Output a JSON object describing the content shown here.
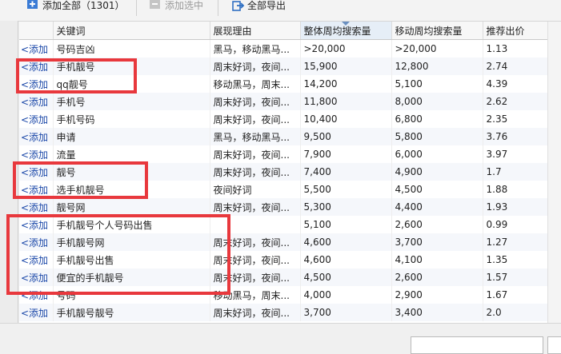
{
  "toolbar": {
    "add_all_label": "添加全部（1301）",
    "add_selected_label": "添加选中",
    "export_all_label": "全部导出"
  },
  "table": {
    "columns": [
      "",
      "关键词",
      "展现理由",
      "整体周均搜索量",
      "移动周均搜索量",
      "推荐出价"
    ],
    "rows": [
      {
        "add": "<添加",
        "keyword": "号码吉凶",
        "reason": "黑马，移动黑马...",
        "total": ">20,000",
        "mobile": ">20,000",
        "bid": "1.13"
      },
      {
        "add": "<添加",
        "keyword": "手机靓号",
        "reason": "周末好词，夜间...",
        "total": "15,900",
        "mobile": "12,800",
        "bid": "2.74"
      },
      {
        "add": "<添加",
        "keyword": "qq靓号",
        "reason": "移动黑马，周末...",
        "total": "14,200",
        "mobile": "5,100",
        "bid": "4.39"
      },
      {
        "add": "<添加",
        "keyword": "手机号",
        "reason": "周末好词，夜间...",
        "total": "11,800",
        "mobile": "8,000",
        "bid": "2.62"
      },
      {
        "add": "<添加",
        "keyword": "手机号码",
        "reason": "周末好词，夜间...",
        "total": "10,400",
        "mobile": "6,800",
        "bid": "2.35"
      },
      {
        "add": "<添加",
        "keyword": "申请",
        "reason": "黑马，移动黑马...",
        "total": "9,500",
        "mobile": "5,800",
        "bid": "3.76"
      },
      {
        "add": "<添加",
        "keyword": "流量",
        "reason": "周末好词，夜间...",
        "total": "7,900",
        "mobile": "6,000",
        "bid": "3.97"
      },
      {
        "add": "<添加",
        "keyword": "靓号",
        "reason": "周末好词，夜间...",
        "total": "7,400",
        "mobile": "4,900",
        "bid": "1.7"
      },
      {
        "add": "<添加",
        "keyword": "选手机靓号",
        "reason": "夜间好词",
        "total": "5,500",
        "mobile": "4,500",
        "bid": "1.88"
      },
      {
        "add": "<添加",
        "keyword": "靓号网",
        "reason": "周末好词，夜间...",
        "total": "5,300",
        "mobile": "4,400",
        "bid": "1.93"
      },
      {
        "add": "<添加",
        "keyword": "手机靓号个人号码出售",
        "reason": "",
        "total": "5,100",
        "mobile": "2,600",
        "bid": "0.99"
      },
      {
        "add": "<添加",
        "keyword": "手机靓号网",
        "reason": "周末好词，夜间...",
        "total": "4,600",
        "mobile": "3,700",
        "bid": "1.27"
      },
      {
        "add": "<添加",
        "keyword": "手机靓号出售",
        "reason": "周末好词，夜间...",
        "total": "4,600",
        "mobile": "4,100",
        "bid": "1.35"
      },
      {
        "add": "<添加",
        "keyword": "便宜的手机靓号",
        "reason": "周末好词，夜间...",
        "total": "4,500",
        "mobile": "2,600",
        "bid": "1.57"
      },
      {
        "add": "<添加",
        "keyword": "号码",
        "reason": "移动黑马，周末...",
        "total": "4,000",
        "mobile": "2,900",
        "bid": "1.67"
      },
      {
        "add": "<添加",
        "keyword": "手机靓号靓号",
        "reason": "周末好词，夜间...",
        "total": "3,700",
        "mobile": "3,400",
        "bid": "2.0"
      }
    ]
  },
  "colors": {
    "highlight": "#e8383d",
    "link": "#1a47a8",
    "sorted_header": "#e6eef7"
  }
}
